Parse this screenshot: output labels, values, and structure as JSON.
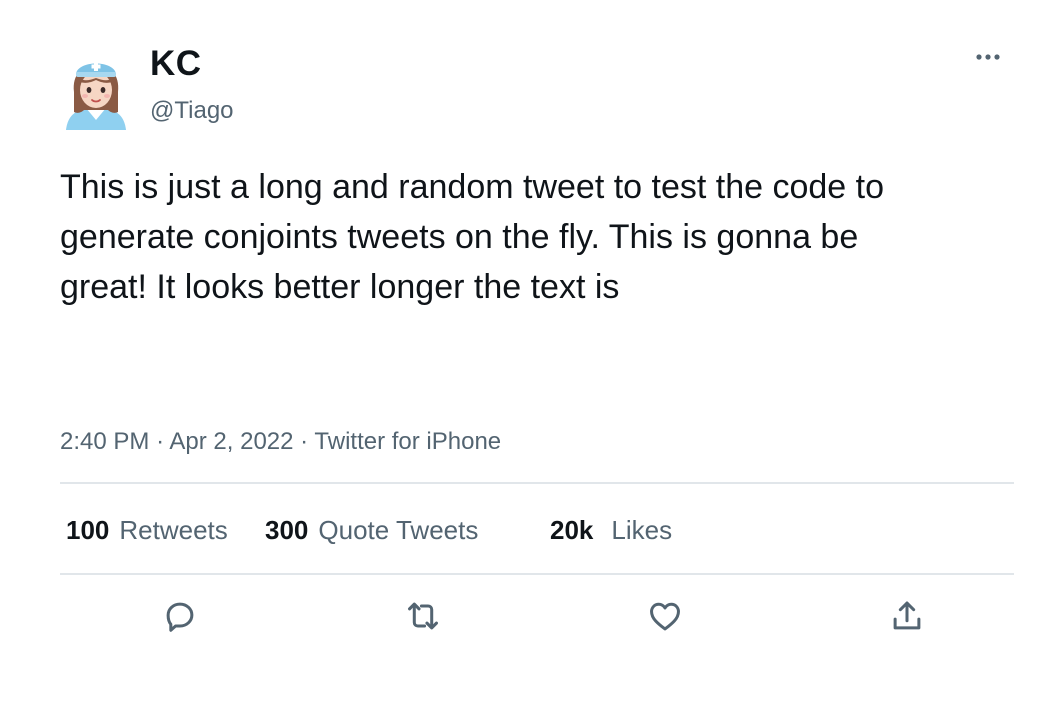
{
  "author": {
    "display_name": "KC",
    "handle": "@Tiago",
    "avatar_icon": "nurse-avatar-icon"
  },
  "tweet": {
    "text": "This is just a long and random tweet to test the code to generate conjoints tweets on the fly. This is gonna be great! It looks better longer the text is",
    "time": "2:40 PM",
    "separator": "·",
    "date": "Apr 2, 2022",
    "source": "Twitter for iPhone"
  },
  "stats": {
    "retweets": {
      "count": "100",
      "label": "Retweets"
    },
    "quote_tweets": {
      "count": "300",
      "label": "Quote Tweets"
    },
    "likes": {
      "count": "20k",
      "label": "Likes"
    }
  },
  "actions": [
    {
      "icon": "reply-icon"
    },
    {
      "icon": "retweet-icon"
    },
    {
      "icon": "like-heart-icon"
    },
    {
      "icon": "share-icon"
    }
  ],
  "menu": {
    "icon": "more-options-icon"
  },
  "colors": {
    "text_primary": "#0f1419",
    "text_secondary": "#536471",
    "divider": "#e1e6ea",
    "avatar_cap": "#7ec3e6",
    "avatar_hair": "#8a5a44"
  }
}
